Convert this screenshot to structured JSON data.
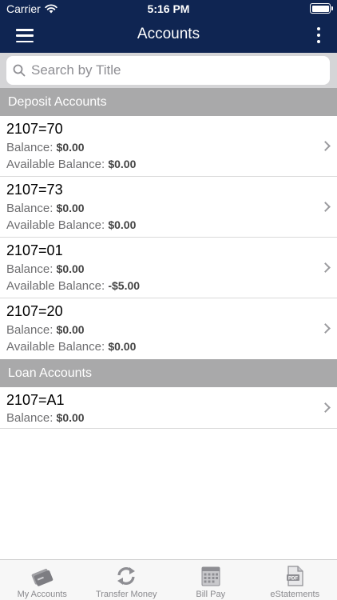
{
  "status": {
    "carrier": "Carrier",
    "time": "5:16 PM",
    "battery_level": 1.0
  },
  "nav": {
    "title": "Accounts"
  },
  "search": {
    "placeholder": "Search by Title",
    "value": ""
  },
  "sections": [
    {
      "title": "Deposit Accounts",
      "accounts": [
        {
          "name": "2107=70",
          "balance_label": "Balance:",
          "balance": "$0.00",
          "available_label": "Available Balance:",
          "available": "$0.00"
        },
        {
          "name": "2107=73",
          "balance_label": "Balance:",
          "balance": "$0.00",
          "available_label": "Available Balance:",
          "available": "$0.00"
        },
        {
          "name": "2107=01",
          "balance_label": "Balance:",
          "balance": "$0.00",
          "available_label": "Available Balance:",
          "available": "-$5.00"
        },
        {
          "name": "2107=20",
          "balance_label": "Balance:",
          "balance": "$0.00",
          "available_label": "Available Balance:",
          "available": "$0.00"
        }
      ]
    },
    {
      "title": "Loan Accounts",
      "accounts": [
        {
          "name": "2107=A1",
          "balance_label": "Balance:",
          "balance": "$0.00"
        }
      ]
    }
  ],
  "tabs": [
    {
      "label": "My Accounts",
      "icon": "cards-icon"
    },
    {
      "label": "Transfer Money",
      "icon": "transfer-arrows-icon"
    },
    {
      "label": "Bill Pay",
      "icon": "calendar-icon"
    },
    {
      "label": "eStatements",
      "icon": "pdf-document-icon"
    }
  ],
  "colors": {
    "header": "#0f2552",
    "section_header": "#a9a9aa",
    "search_bg": "#d5d5d7"
  }
}
